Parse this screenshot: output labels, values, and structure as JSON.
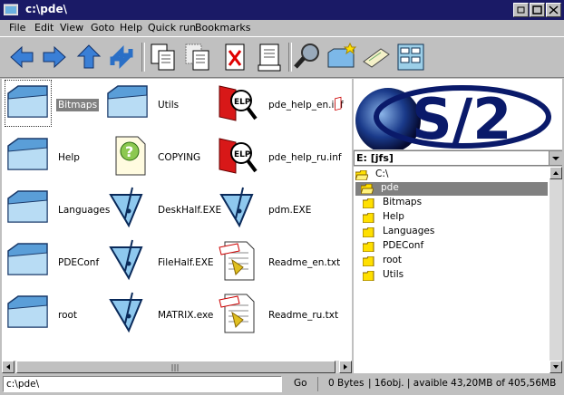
{
  "window": {
    "title": "c:\\pde\\"
  },
  "menu": [
    "File",
    "Edit",
    "View",
    "Goto",
    "Help",
    "Quick run",
    "Bookmarks"
  ],
  "toolbar": [
    {
      "name": "back-arrow-icon"
    },
    {
      "name": "forward-arrow-icon"
    },
    {
      "name": "up-arrow-icon"
    },
    {
      "name": "refresh-icon"
    },
    {
      "name": "copy-icon"
    },
    {
      "name": "move-icon"
    },
    {
      "name": "delete-icon"
    },
    {
      "name": "rename-icon"
    },
    {
      "name": "search-icon"
    },
    {
      "name": "new-folder-icon"
    },
    {
      "name": "properties-icon"
    },
    {
      "name": "drives-icon"
    }
  ],
  "files": [
    {
      "label": "Bitmaps",
      "type": "folder"
    },
    {
      "label": "Help",
      "type": "folder"
    },
    {
      "label": "Languages",
      "type": "folder"
    },
    {
      "label": "PDEConf",
      "type": "folder"
    },
    {
      "label": "root",
      "type": "folder"
    },
    {
      "label": "Utils",
      "type": "folder"
    },
    {
      "label": "COPYING",
      "type": "doc"
    },
    {
      "label": "DeskHalf.EXE",
      "type": "exe"
    },
    {
      "label": "FileHalf.EXE",
      "type": "exe"
    },
    {
      "label": "MATRIX.exe",
      "type": "exe"
    },
    {
      "label": "pde_help_en.inf",
      "type": "inf"
    },
    {
      "label": "pde_help_ru.inf",
      "type": "inf"
    },
    {
      "label": "pdm.EXE",
      "type": "exe"
    },
    {
      "label": "Readme_en.txt",
      "type": "txt"
    },
    {
      "label": "Readme_ru.txt",
      "type": "txt"
    }
  ],
  "logo": {
    "text": "S/2"
  },
  "drive": {
    "label": "E: [jfs]"
  },
  "tree": [
    {
      "label": "C:\\",
      "level": 0
    },
    {
      "label": "pde",
      "level": 1,
      "selected": true
    },
    {
      "label": "Bitmaps",
      "level": 2
    },
    {
      "label": "Help",
      "level": 2
    },
    {
      "label": "Languages",
      "level": 2
    },
    {
      "label": "PDEConf",
      "level": 2
    },
    {
      "label": "root",
      "level": 2
    },
    {
      "label": "Utils",
      "level": 2
    }
  ],
  "status": {
    "path": "c:\\pde\\",
    "go": "Go",
    "size": "0 Bytes",
    "info": "| 16obj. | avaible 43,20MB of 405,56MB"
  },
  "colors": {
    "titlebar": "#1a1a66",
    "folder": "#ffe000",
    "selection": "#808080"
  }
}
